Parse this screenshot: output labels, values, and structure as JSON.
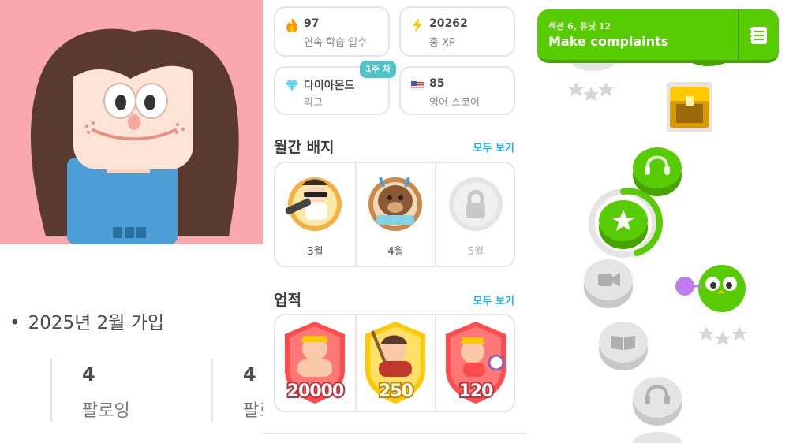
{
  "profile": {
    "joined": "2025년 2월 가입",
    "stats": [
      {
        "value": "4",
        "label": "팔로잉"
      },
      {
        "value": "4",
        "label": "팔로워"
      }
    ]
  },
  "stats_cards": [
    {
      "value": "97",
      "label": "연속 학습 일수",
      "icon": "fire-icon"
    },
    {
      "value": "20262",
      "label": "총 XP",
      "icon": "lightning-icon"
    },
    {
      "value": "다이아몬드",
      "label": "리그",
      "icon": "diamond-icon",
      "tag": "1주 차"
    },
    {
      "value": "85",
      "label": "영어 스코어",
      "icon": "us-flag-icon"
    }
  ],
  "monthly_badges": {
    "title": "월간 배지",
    "see_all": "모두 보기",
    "items": [
      {
        "label": "3월",
        "locked": false
      },
      {
        "label": "4월",
        "locked": false
      },
      {
        "label": "5월",
        "locked": true
      }
    ]
  },
  "achievements": {
    "title": "업적",
    "see_all": "모두 보기",
    "items": [
      {
        "value": "20000",
        "name": "strength"
      },
      {
        "value": "250",
        "name": "artist"
      },
      {
        "value": "120",
        "name": "timer"
      }
    ]
  },
  "path": {
    "section_label": "섹션 6, 유닛 12",
    "unit_title": "Make complaints",
    "colors": {
      "green": "#58cc02",
      "green_dark": "#46a302",
      "gray": "#e5e5e5",
      "gold": "#ffc800"
    }
  }
}
